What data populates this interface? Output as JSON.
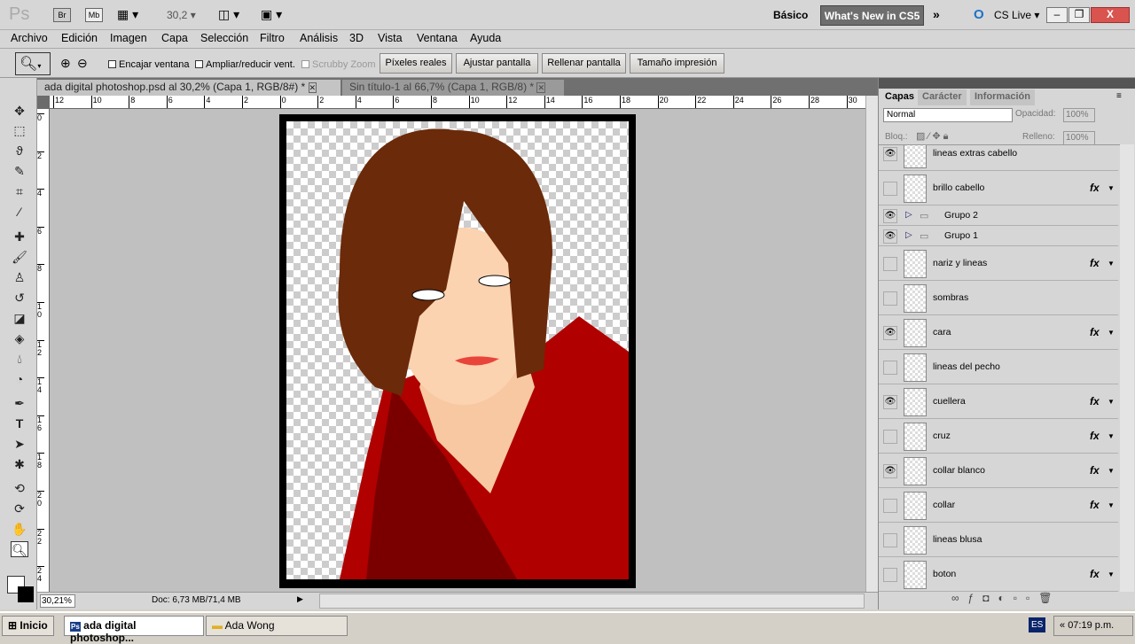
{
  "appbar": {
    "logo": "Ps",
    "bridge": "Br",
    "minibridge": "Mb",
    "zoom": "30,2",
    "workspace": "Básico",
    "whats_new": "What's New in CS5",
    "cs_live": "CS Live"
  },
  "menu": [
    "Archivo",
    "Edición",
    "Imagen",
    "Capa",
    "Selección",
    "Filtro",
    "Análisis",
    "3D",
    "Vista",
    "Ventana",
    "Ayuda"
  ],
  "options": {
    "checks": [
      {
        "label": "Encajar ventana",
        "checked": false
      },
      {
        "label": "Ampliar/reducir vent.",
        "checked": false
      },
      {
        "label": "Scrubby Zoom",
        "checked": false,
        "disabled": true
      }
    ],
    "buttons": [
      "Píxeles reales",
      "Ajustar pantalla",
      "Rellenar pantalla",
      "Tamaño impresión"
    ]
  },
  "tabs": [
    {
      "label": "ada digital photoshop.psd al 30,2% (Capa 1, RGB/8#) *",
      "active": true
    },
    {
      "label": "Sin título-1 al 66,7% (Capa 1, RGB/8) *",
      "active": false
    }
  ],
  "ruler": {
    "h": [
      "12",
      "10",
      "8",
      "6",
      "4",
      "2",
      "0",
      "2",
      "4",
      "6",
      "8",
      "10",
      "12",
      "14",
      "16",
      "18",
      "20",
      "22",
      "24",
      "26",
      "28",
      "30"
    ],
    "v": [
      "0",
      "2",
      "4",
      "6",
      "8",
      "1 0",
      "1 2",
      "1 4",
      "1 6",
      "1 8",
      "2 0",
      "2 2",
      "2 4"
    ]
  },
  "status": {
    "zoom": "30,21%",
    "doc": "Doc: 6,73 MB/71,4 MB"
  },
  "panel": {
    "tabs": [
      "Capas",
      "Carácter",
      "Información"
    ],
    "blend": "Normal",
    "opacity_label": "Opacidad:",
    "opacity": "100%",
    "lock_label": "Bloq.:",
    "fill_label": "Relleno:",
    "fill": "100%",
    "layers": [
      {
        "name": "lineas extras cabello",
        "visible": true,
        "fx": false
      },
      {
        "name": "brillo cabello",
        "visible": false,
        "fx": true
      },
      {
        "name": "Grupo 2",
        "visible": true,
        "fx": false,
        "group": true
      },
      {
        "name": "Grupo 1",
        "visible": true,
        "fx": false,
        "group": true
      },
      {
        "name": "nariz y lineas",
        "visible": false,
        "fx": true
      },
      {
        "name": "sombras",
        "visible": false,
        "fx": false
      },
      {
        "name": "cara",
        "visible": true,
        "fx": true
      },
      {
        "name": "lineas del pecho",
        "visible": false,
        "fx": false
      },
      {
        "name": "cuellera",
        "visible": true,
        "fx": true
      },
      {
        "name": "cruz",
        "visible": false,
        "fx": true
      },
      {
        "name": "collar blanco",
        "visible": true,
        "fx": true
      },
      {
        "name": "collar",
        "visible": false,
        "fx": true
      },
      {
        "name": "lineas blusa",
        "visible": false,
        "fx": false
      },
      {
        "name": "boton",
        "visible": false,
        "fx": true
      }
    ]
  },
  "taskbar": {
    "start": "Inicio",
    "items": [
      "ada digital photoshop...",
      "Ada Wong"
    ],
    "lang": "ES",
    "time": "07:19 p.m."
  }
}
